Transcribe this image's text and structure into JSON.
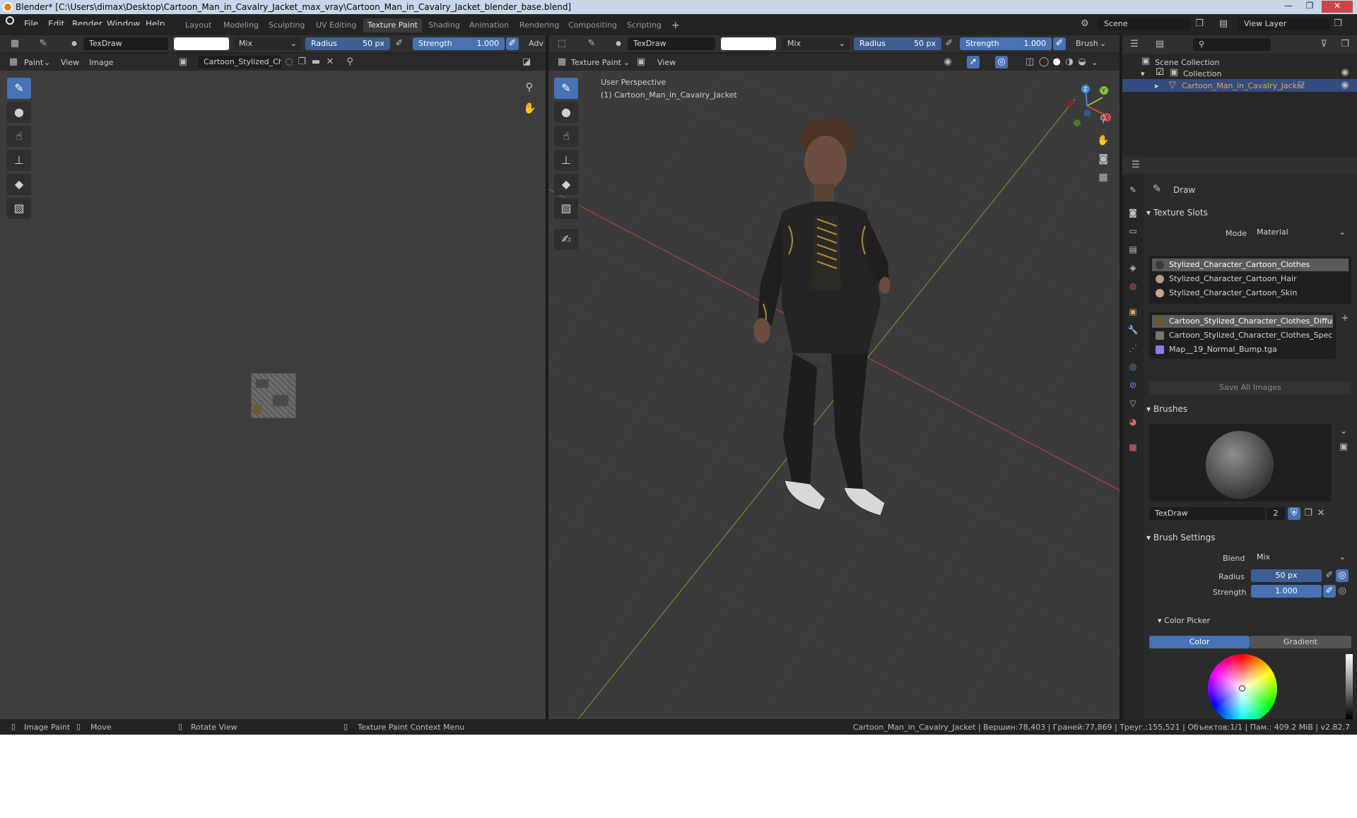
{
  "titlebar": {
    "title": "Blender* [C:\\Users\\dimax\\Desktop\\Cartoon_Man_in_Cavalry_Jacket_max_vray\\Cartoon_Man_in_Cavalry_Jacket_blender_base.blend]",
    "minimize": "—",
    "maximize": "❐",
    "close": "✕"
  },
  "menu": {
    "file": "File",
    "edit": "Edit",
    "render": "Render",
    "window": "Window",
    "help": "Help"
  },
  "workspaces": {
    "layout": "Layout",
    "modeling": "Modeling",
    "sculpting": "Sculpting",
    "uv_editing": "UV Editing",
    "texture_paint": "Texture Paint",
    "shading": "Shading",
    "animation": "Animation",
    "rendering": "Rendering",
    "compositing": "Compositing",
    "scripting": "Scripting",
    "add": "+"
  },
  "scene": {
    "scene_label": "Scene",
    "view_layer_label": "View Layer"
  },
  "left_header": {
    "brush_name": "TexDraw",
    "blend": "Mix",
    "radius_label": "Radius",
    "radius_value": "50 px",
    "strength_label": "Strength",
    "strength_value": "1.000",
    "adv": "Adv",
    "mode": "Paint",
    "view": "View",
    "image": "Image",
    "image_name": "Cartoon_Stylized_Ch.."
  },
  "viewport_header": {
    "brush_name": "TexDraw",
    "blend": "Mix",
    "radius_label": "Radius",
    "radius_value": "50 px",
    "strength_label": "Strength",
    "strength_value": "1.000",
    "brush_menu": "Brush",
    "mode": "Texture Paint",
    "view": "View",
    "overlay_title": "User Perspective",
    "overlay_object": "(1) Cartoon_Man_in_Cavalry_Jacket"
  },
  "outliner": {
    "scene_collection": "Scene Collection",
    "collection": "Collection",
    "object": "Cartoon_Man_in_Cavalry_Jacket"
  },
  "properties": {
    "tool_name": "Draw",
    "texture_slots_title": "Texture Slots",
    "mode_label": "Mode",
    "mode_value": "Material",
    "materials": [
      {
        "name": "Stylized_Character_Cartoon_Clothes",
        "color": "#3a3a3a"
      },
      {
        "name": "Stylized_Character_Cartoon_Hair",
        "color": "#b89a84"
      },
      {
        "name": "Stylized_Character_Cartoon_Skin",
        "color": "#c9a58a"
      }
    ],
    "images": [
      {
        "name": "Cartoon_Stylized_Character_Clothes_Diffus..",
        "color": "#6b5a2a"
      },
      {
        "name": "Cartoon_Stylized_Character_Clothes_Spec..",
        "color": "#777777"
      },
      {
        "name": "Map__19_Normal_Bump.tga",
        "color": "#8a7cf0"
      }
    ],
    "save_all": "Save All Images",
    "brushes_title": "Brushes",
    "brush_name": "TexDraw",
    "brush_users": "2",
    "brush_settings_title": "Brush Settings",
    "blend_label": "Blend",
    "blend_value": "Mix",
    "radius_label": "Radius",
    "radius_value": "50 px",
    "strength_label": "Strength",
    "strength_value": "1.000",
    "color_picker_title": "Color Picker",
    "color_tab": "Color",
    "gradient_tab": "Gradient"
  },
  "statusbar": {
    "image_paint": "Image Paint",
    "move": "Move",
    "rotate_view": "Rotate View",
    "context_menu": "Texture Paint Context Menu",
    "stats": "Cartoon_Man_in_Cavalry_Jacket | Вершин:78,403 | Граней:77,869 | Треуг.:155,521 | Объектов:1/1 | Пам.: 409.2 MiB | v2.82.7"
  },
  "axis_labels": {
    "x": "X",
    "y": "Y",
    "z": "Z"
  },
  "colors": {
    "accent": "#4772b3",
    "bg_dark": "#232323",
    "viewport": "#3b3b3b",
    "axis_x": "#d7454e",
    "axis_y": "#8bbf3c",
    "axis_z": "#3d8be0"
  },
  "icons": {
    "tool_draw": "brush-icon",
    "tool_soften": "drop-icon",
    "tool_smear": "smear-icon",
    "tool_clone": "stamp-icon",
    "tool_fill": "bucket-icon",
    "tool_mask": "mask-icon",
    "annotate": "pencil-icon",
    "zoom": "magnifier-icon",
    "pan": "hand-icon",
    "camera": "camera-icon",
    "ortho": "grid-icon"
  }
}
